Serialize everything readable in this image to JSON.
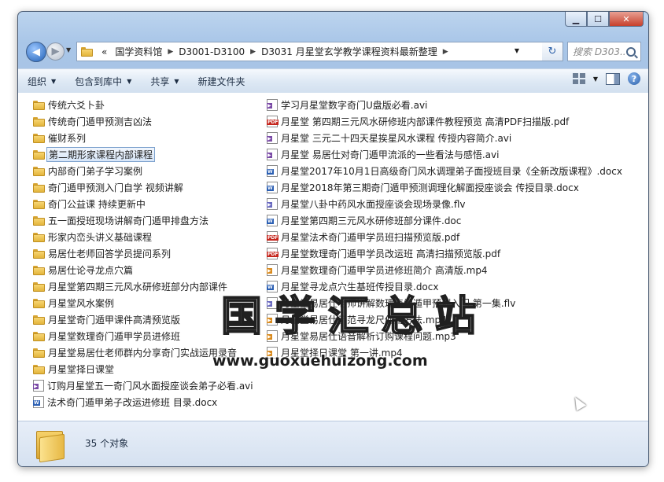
{
  "window": {
    "minimize": "▁",
    "maximize": "☐",
    "close": "✕"
  },
  "address": {
    "prefix": "«",
    "crumbs": [
      "国学资料馆",
      "D3001-D3100",
      "D3031 月星堂玄学教学课程资料最新整理"
    ]
  },
  "search": {
    "placeholder": "搜索 D303..."
  },
  "toolbar": {
    "organize": "组织",
    "include_in_library": "包含到库中",
    "share": "共享",
    "new_folder": "新建文件夹"
  },
  "files_left": [
    {
      "name": "传统六爻卜卦",
      "type": "folder"
    },
    {
      "name": "传统奇门遁甲预测吉凶法",
      "type": "folder"
    },
    {
      "name": "催财系列",
      "type": "folder"
    },
    {
      "name": "第二期形家课程内部课程",
      "type": "folder",
      "selected": true
    },
    {
      "name": "内部奇门弟子学习案例",
      "type": "folder"
    },
    {
      "name": "奇门遁甲预测入门自学 视频讲解",
      "type": "folder"
    },
    {
      "name": "奇门公益课 持续更新中",
      "type": "folder"
    },
    {
      "name": "五一面授班现场讲解奇门遁甲排盘方法",
      "type": "folder"
    },
    {
      "name": "形家内峦头讲义基础课程",
      "type": "folder"
    },
    {
      "name": "易居仕老师回答学员提问系列",
      "type": "folder"
    },
    {
      "name": "易居仕论寻龙点穴篇",
      "type": "folder"
    },
    {
      "name": "月星堂第四期三元风水研修班部分内部课件",
      "type": "folder"
    },
    {
      "name": "月星堂风水案例",
      "type": "folder"
    },
    {
      "name": "月星堂奇门遁甲课件高清预览版",
      "type": "folder"
    },
    {
      "name": "月星堂数理奇门遁甲学员进修班",
      "type": "folder"
    },
    {
      "name": "月星堂易居仕老师群内分享奇门实战运用录音",
      "type": "folder"
    },
    {
      "name": "月星堂择日课堂",
      "type": "folder"
    },
    {
      "name": "订购月星堂五一奇门风水面授座谈会弟子必看.avi",
      "type": "avi"
    },
    {
      "name": "法术奇门遁甲弟子改运进修班  目录.docx",
      "type": "doc"
    }
  ],
  "files_right": [
    {
      "name": "学习月星堂数字奇门U盘版必看.avi",
      "type": "avi"
    },
    {
      "name": "月星堂 第四期三元风水研修班内部课件教程预览 高清PDF扫描版.pdf",
      "type": "pdf"
    },
    {
      "name": "月星堂 三元二十四天星挨星风水课程 传授内容简介.avi",
      "type": "avi"
    },
    {
      "name": "月星堂 易居仕对奇门遁甲流派的一些看法与感悟.avi",
      "type": "avi"
    },
    {
      "name": "月星堂2017年10月1日高级奇门风水调理弟子面授班目录《全新改版课程》.docx",
      "type": "doc"
    },
    {
      "name": "月星堂2018年第三期奇门遁甲预测调理化解面授座谈会 传授目录.docx",
      "type": "doc"
    },
    {
      "name": "月星堂八卦中药风水面授座谈会现场录像.flv",
      "type": "flv"
    },
    {
      "name": "月星堂第四期三元风水研修班部分课件.doc",
      "type": "doc"
    },
    {
      "name": "月星堂法术奇门遁甲学员班扫描预览版.pdf",
      "type": "pdf"
    },
    {
      "name": "月星堂数理奇门遁甲学员改运班 高清扫描预览版.pdf",
      "type": "pdf"
    },
    {
      "name": "月星堂数理奇门遁甲学员进修班简介 高清版.mp4",
      "type": "mp4"
    },
    {
      "name": "月星堂寻龙点穴生基班传授目录.docx",
      "type": "doc"
    },
    {
      "name": "月星堂易居仕老师讲解数理奇门遁甲预测入门 第一集.flv",
      "type": "flv"
    },
    {
      "name": "月星堂易居仕示范寻龙尺使用方法.mp4",
      "type": "mp4"
    },
    {
      "name": "月星堂易居仕语音解析订购课程问题.mp3",
      "type": "mp3"
    },
    {
      "name": "月星堂择日课堂 第一讲.mp4",
      "type": "mp4"
    }
  ],
  "watermark": {
    "title": "国学汇总站",
    "url": "www.guoxuehuizong.com"
  },
  "status": {
    "count": "35 个对象"
  }
}
